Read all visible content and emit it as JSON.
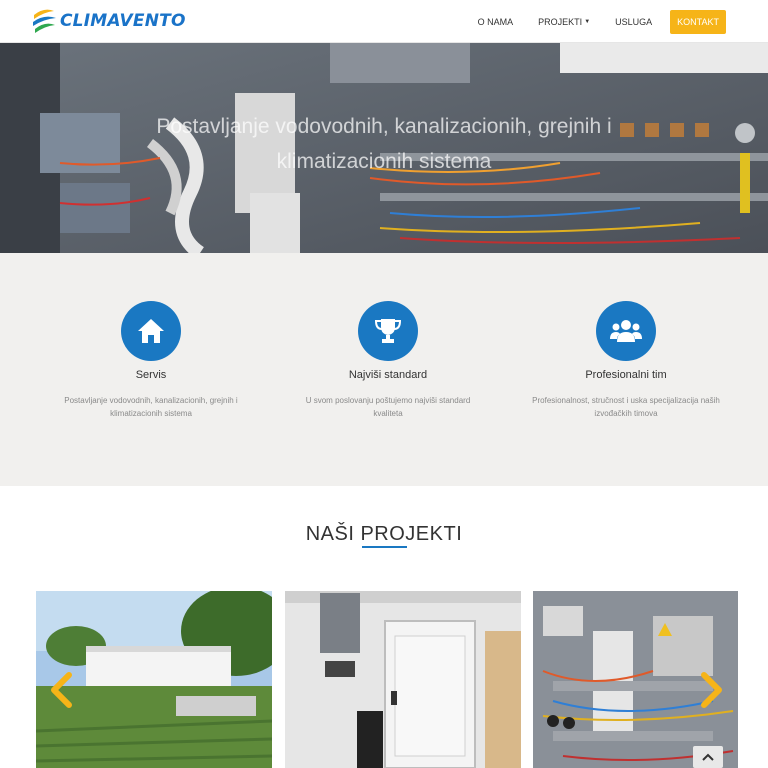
{
  "brand": {
    "name": "CLIMAVENTO"
  },
  "nav": {
    "items": [
      {
        "label": "O NAMA"
      },
      {
        "label": "PROJEKTI"
      },
      {
        "label": "USLUGA"
      }
    ],
    "cta": "KONTAKT"
  },
  "hero": {
    "title": "Postavljanje vodovodnih, kanalizacionih, grejnih i klimatizacionih sistema"
  },
  "features": [
    {
      "icon": "home-icon",
      "title": "Servis",
      "desc": "Postavljanje vodovodnih, kanalizacionih, grejnih i klimatizacionih sistema"
    },
    {
      "icon": "trophy-icon",
      "title": "Najviši standard",
      "desc": "U svom poslovanju poštujemo najviši standard kvaliteta"
    },
    {
      "icon": "users-icon",
      "title": "Profesionalni tim",
      "desc": "Profesionalnost, stručnost i uska specijalizacija naših izvođačkih timova"
    }
  ],
  "projects": {
    "title": "NAŠI PROJEKTI",
    "items": [
      {
        "image": "building-construction-photo"
      },
      {
        "image": "cold-room-door-photo"
      },
      {
        "image": "electrical-panel-photo"
      }
    ]
  },
  "colors": {
    "accent": "#1a78c2",
    "cta": "#f6b418",
    "features_bg": "#f1f0ee"
  }
}
